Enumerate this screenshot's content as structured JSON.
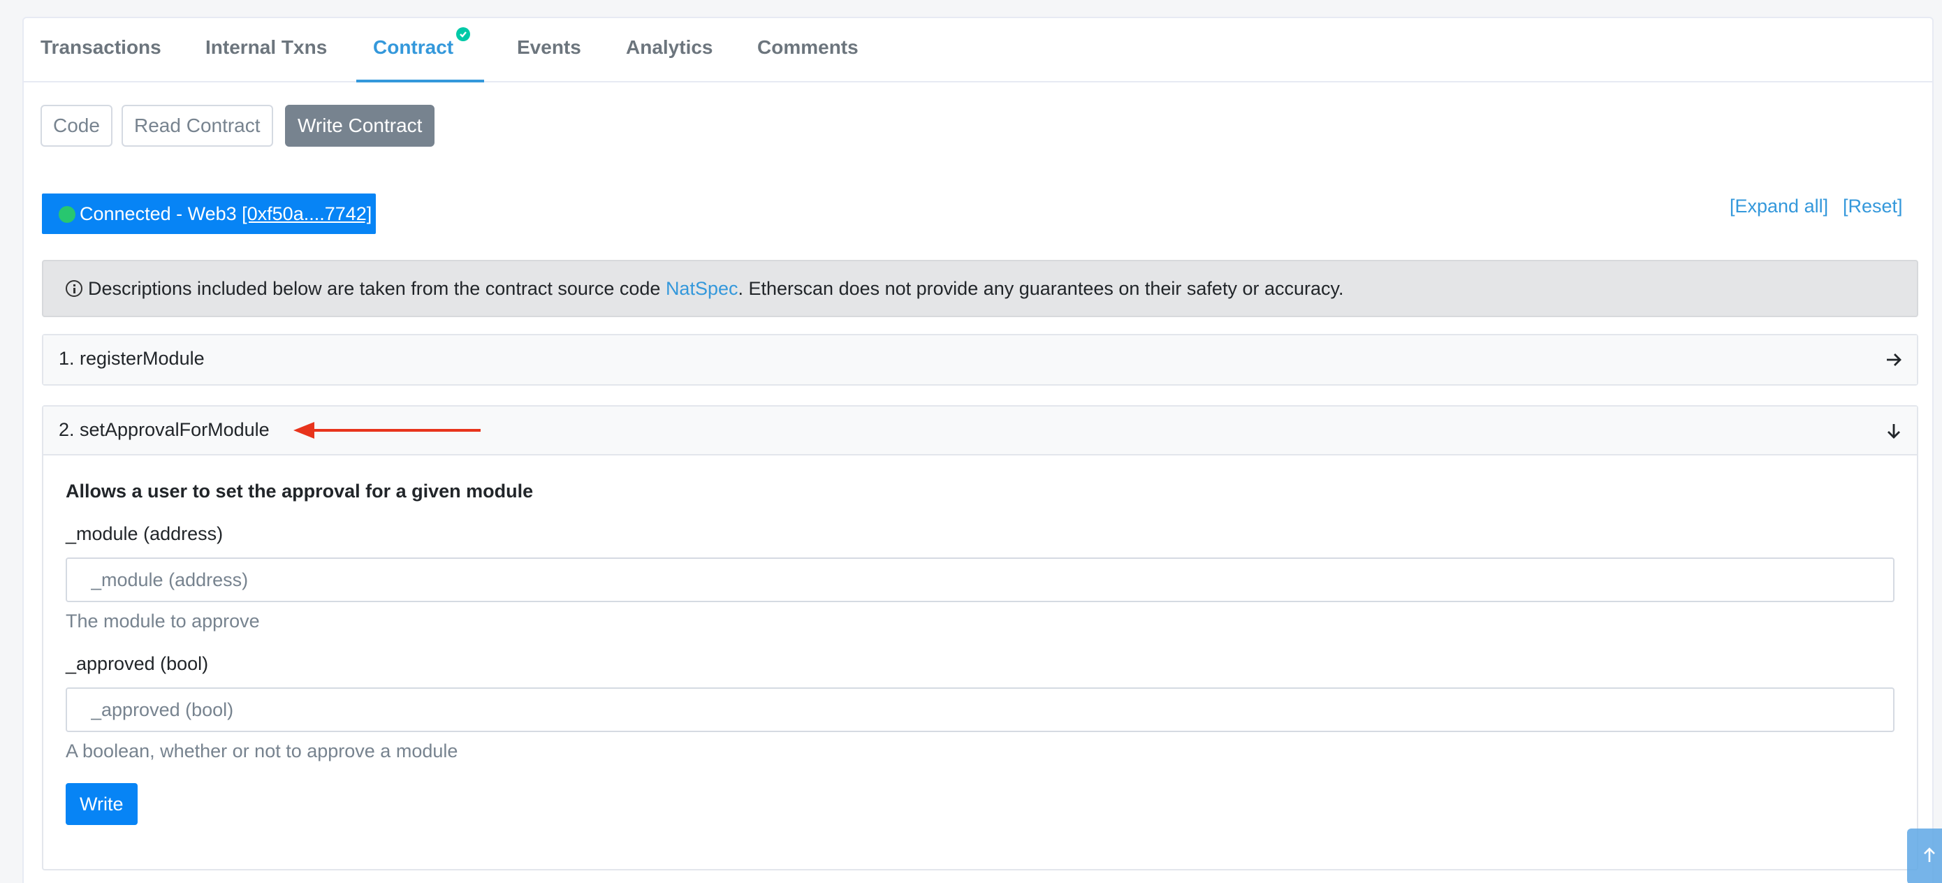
{
  "tabs": [
    {
      "label": "Transactions"
    },
    {
      "label": "Internal Txns"
    },
    {
      "label": "Contract"
    },
    {
      "label": "Events"
    },
    {
      "label": "Analytics"
    },
    {
      "label": "Comments"
    }
  ],
  "subtabs": {
    "code": "Code",
    "read": "Read Contract",
    "write": "Write Contract"
  },
  "connection": {
    "status": "Connected - Web3 ",
    "address": "[0xf50a....7742]"
  },
  "links": {
    "expand_all": "[Expand all]",
    "reset": "[Reset]"
  },
  "banner": {
    "text_before": "Descriptions included below are taken from the contract source code ",
    "link": "NatSpec",
    "text_after": ". Etherscan does not provide any guarantees on their safety or accuracy."
  },
  "functions": [
    {
      "title": "1. registerModule"
    },
    {
      "title": "2. setApprovalForModule",
      "description": "Allows a user to set the approval for a given module",
      "params": [
        {
          "label": "_module (address)",
          "placeholder": "_module (address)",
          "help": "The module to approve"
        },
        {
          "label": "_approved (bool)",
          "placeholder": "_approved (bool)",
          "help": "A boolean, whether or not to approve a module"
        }
      ],
      "button": "Write"
    }
  ],
  "colors": {
    "accent": "#3498db",
    "primary_button": "#0784f5",
    "annotation_arrow": "#e8341c",
    "connected_dot": "#28c76f"
  }
}
